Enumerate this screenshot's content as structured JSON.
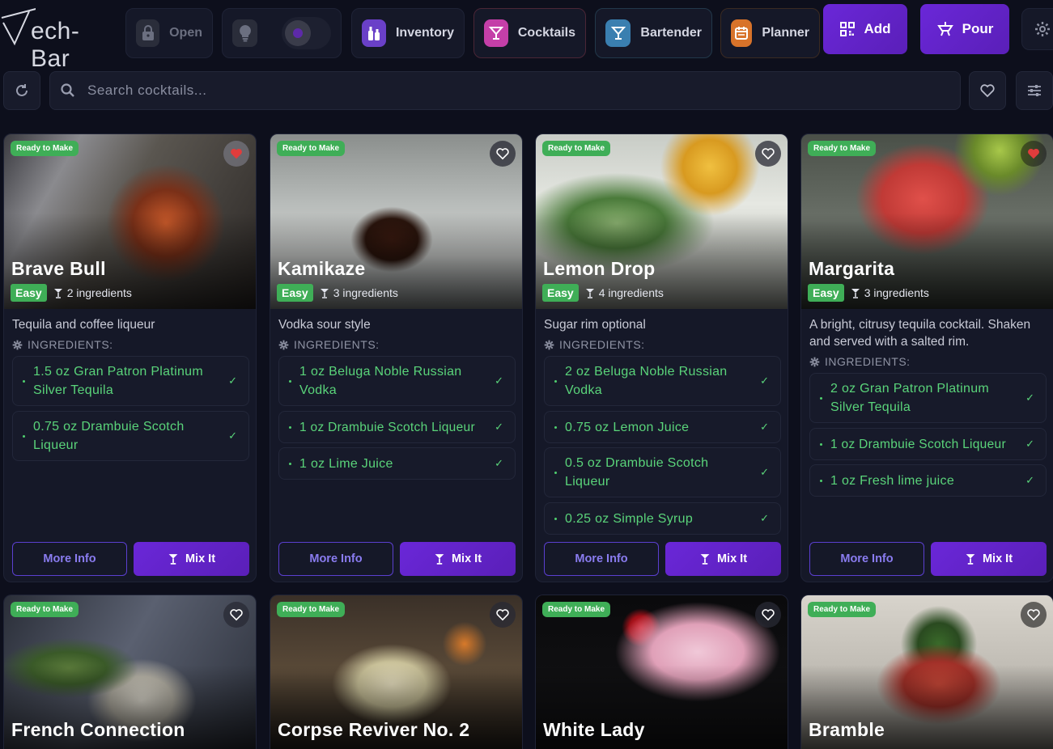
{
  "app": {
    "logo_text": "ech-Bar"
  },
  "nav": {
    "open_label": "Open",
    "inventory_label": "Inventory",
    "cocktails_label": "Cocktails",
    "bartender_label": "Bartender",
    "planner_label": "Planner",
    "add_label": "Add",
    "pour_label": "Pour"
  },
  "search": {
    "placeholder": "Search cocktails..."
  },
  "labels": {
    "ready": "Ready to Make",
    "easy": "Easy",
    "ingredients_header": "INGREDIENTS:",
    "more_info": "More Info",
    "mix_it": "Mix It"
  },
  "colors": {
    "accent": "#6a27d8",
    "success": "#3fae57",
    "ingredient": "#5ad47a",
    "favorite": "#e03c3c"
  },
  "cards": [
    {
      "title": "Brave Bull",
      "count": "2 ingredients",
      "favorite": true,
      "description": "Tequila and coffee liqueur",
      "ingredients": [
        "1.5 oz Gran Patron Platinum Silver Tequila",
        "0.75 oz Drambuie Scotch Liqueur"
      ]
    },
    {
      "title": "Kamikaze",
      "count": "3 ingredients",
      "favorite": false,
      "description": "Vodka sour style",
      "ingredients": [
        "1 oz Beluga Noble Russian Vodka",
        "1 oz Drambuie Scotch Liqueur",
        "1 oz Lime Juice"
      ]
    },
    {
      "title": "Lemon Drop",
      "count": "4 ingredients",
      "favorite": false,
      "description": "Sugar rim optional",
      "ingredients": [
        "2 oz Beluga Noble Russian Vodka",
        "0.75 oz Lemon Juice",
        "0.5 oz Drambuie Scotch Liqueur",
        "0.25 oz Simple Syrup"
      ]
    },
    {
      "title": "Margarita",
      "count": "3 ingredients",
      "favorite": true,
      "description": "A bright, citrusy tequila cocktail. Shaken and served with a salted rim.",
      "ingredients": [
        "2 oz Gran Patron Platinum Silver Tequila",
        "1 oz Drambuie Scotch Liqueur",
        "1 oz Fresh lime juice"
      ]
    },
    {
      "title": "French Connection",
      "favorite": false
    },
    {
      "title": "Corpse Reviver No. 2",
      "favorite": false
    },
    {
      "title": "White Lady",
      "favorite": false
    },
    {
      "title": "Bramble",
      "favorite": false
    }
  ]
}
